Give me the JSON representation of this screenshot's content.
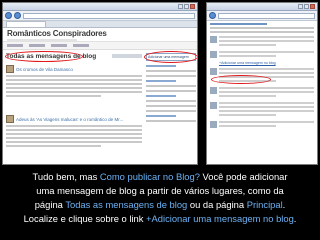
{
  "left_window": {
    "blog_title": "Românticos Conspiradores",
    "page_heading": "Todas as mensagens de blog",
    "posts": [
      {
        "title": "Os cromos de Vila Damasco"
      },
      {
        "title": "Adeus às 'As Viagens malucas' e o romântico de Mr..."
      }
    ],
    "sidebar_button": "Adicionar uma mensagem"
  },
  "right_window": {
    "add_link": "+Adicionar uma mensagem no blog"
  },
  "caption": {
    "l1_a": "Tudo bem, mas ",
    "l1_b": "Como publicar no Blog?",
    "l1_c": " Você pode adicionar",
    "l2": "uma mensagem de blog a partir de vários lugares, como da",
    "l3_a": "página ",
    "l3_b": "Todas as mensagens de blog",
    "l3_c": " ou da página ",
    "l3_d": "Principal",
    "l3_e": ".",
    "l4_a": "Localize e clique sobre o link ",
    "l4_b": "+Adicionar uma mensagem no blog",
    "l4_c": "."
  },
  "colors": {
    "highlight": "#6cb2f5",
    "callout": "#e0181b",
    "background": "#000000"
  }
}
